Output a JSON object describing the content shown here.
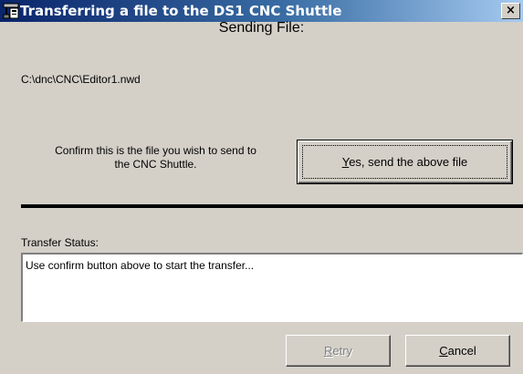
{
  "window": {
    "title": "Transferring a file to the DS1 CNC Shuttle",
    "icon": "cnc-machine-icon",
    "close_symbol": "×"
  },
  "main": {
    "heading": "Sending File:",
    "file_path": "C:\\dnc\\CNC\\Editor1.nwd",
    "confirm_line1": "Confirm this is the file you wish to send to",
    "confirm_line2": "the CNC Shuttle.",
    "yes_button": {
      "mnemonic": "Y",
      "rest": "es, send the above file"
    }
  },
  "status": {
    "label": "Transfer Status:",
    "message": "Use confirm button above to start the transfer..."
  },
  "buttons": {
    "retry": {
      "mnemonic": "R",
      "rest": "etry",
      "enabled": false
    },
    "cancel": {
      "mnemonic": "C",
      "rest": "ancel",
      "enabled": true
    }
  },
  "colors": {
    "title_gradient_start": "#0a246a",
    "title_gradient_end": "#a6caf0",
    "dialog_background": "#d4d0c8",
    "divider": "#000000"
  }
}
